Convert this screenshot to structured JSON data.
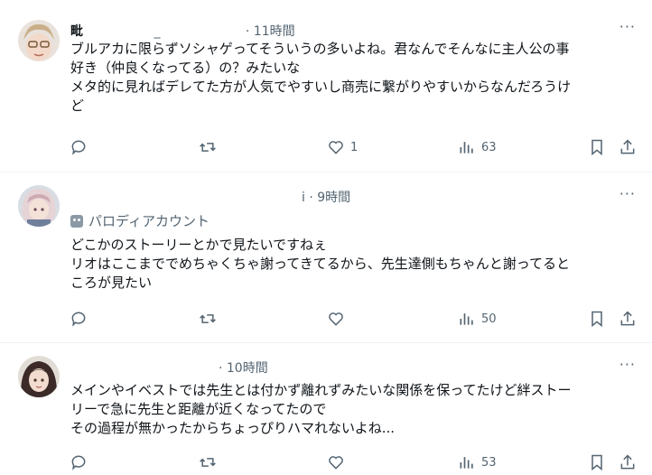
{
  "posts": [
    {
      "display_name": "毗",
      "separator": "_",
      "time": "· 11時間",
      "more": "···",
      "lines": [
        "ブルアカに限らずソシャゲってそういうの多いよね。君なんでそんなに主人公の事",
        "好き（仲良くなってる）の？みたいな",
        "メタ的に見ればデレてた方が人気でやすいし商売に繋がりやすいからなんだろうけ",
        "ど"
      ],
      "stats": {
        "replies": "",
        "reposts": "",
        "likes": "1",
        "views": "63"
      }
    },
    {
      "display_name": "",
      "separator": "",
      "time": "i · 9時間",
      "more": "···",
      "badge": "パロディアカウント",
      "lines": [
        "どこかのストーリーとかで見たいですねぇ",
        "リオはここまででめちゃくちゃ謝ってきてるから、先生達側もちゃんと謝ってると",
        "ころが見たい"
      ],
      "stats": {
        "replies": "",
        "reposts": "",
        "likes": "",
        "views": "50"
      }
    },
    {
      "display_name": "",
      "separator": "",
      "time": "· 10時間",
      "more": "···",
      "lines": [
        "メインやイベストでは先生とは付かず離れずみたいな関係を保ってたけど絆ストー",
        "リーで急に先生と距離が近くなってたので",
        "その過程が無かったからちょっぴりハマれないよね..."
      ],
      "stats": {
        "replies": "",
        "reposts": "",
        "likes": "",
        "views": "53"
      }
    }
  ],
  "icons": {
    "reply": "reply-icon",
    "repost": "repost-icon",
    "like": "like-icon",
    "views": "views-icon",
    "bookmark": "bookmark-icon",
    "share": "share-icon"
  }
}
